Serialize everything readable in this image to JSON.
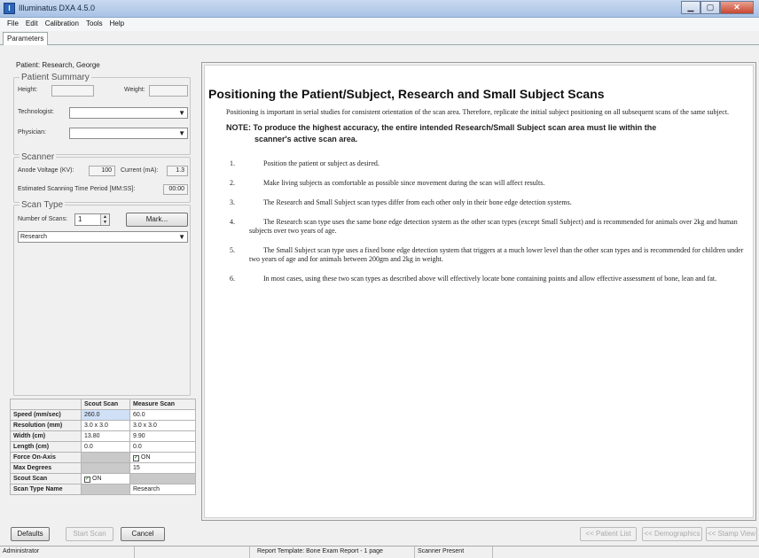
{
  "window": {
    "title": "Illuminatus DXA 4.5.0",
    "icon": "app-icon",
    "min": "▁",
    "max": "▢",
    "close": "✕"
  },
  "menu": [
    "File",
    "Edit",
    "Calibration",
    "Tools",
    "Help"
  ],
  "tabs": {
    "active": "Parameters"
  },
  "left": {
    "patient_label": "Patient:",
    "patient_name": "Research, George",
    "summary": {
      "title": "Patient Summary",
      "height_label": "Height:",
      "weight_label": "Weight:",
      "technologist_label": "Technologist:",
      "physician_label": "Physician:",
      "technologist_value": "",
      "physician_value": ""
    },
    "scanner": {
      "title": "Scanner",
      "voltage_label": "Anode Voltage (KV):",
      "voltage_value": "100",
      "current_label": "Current (mA):",
      "current_value": "1.3",
      "time_label": "Estimated Scanning Time Period [MM:SS]:",
      "time_value": "00:00"
    },
    "scan_type": {
      "title": "Scan Type",
      "num_label": "Number of Scans:",
      "num_value": "1",
      "mark_button": "Mark...",
      "type_value": "Research"
    }
  },
  "table": {
    "headers": [
      "",
      "Scout Scan",
      "Measure Scan"
    ],
    "rows": [
      {
        "label": "Speed (mm/sec)",
        "scout": "260.0",
        "measure": "60.0"
      },
      {
        "label": "Resolution (mm)",
        "scout": "3.0 x 3.0",
        "measure": "3.0 x 3.0"
      },
      {
        "label": "Width (cm)",
        "scout": "13.80",
        "measure": "9.90"
      },
      {
        "label": "Length (cm)",
        "scout": "0.0",
        "measure": "0.0"
      },
      {
        "label": "Force On-Axis",
        "scout": "",
        "measure": "ON"
      },
      {
        "label": "Max Degrees",
        "scout": "",
        "measure": "15"
      },
      {
        "label": "Scout Scan",
        "scout": "ON",
        "measure": ""
      },
      {
        "label": "Scan Type Name",
        "scout": "",
        "measure": "Research"
      }
    ]
  },
  "doc": {
    "title": "Positioning the Patient/Subject, Research and Small Subject Scans",
    "intro": "Positioning is important in serial studies for consistent orientation of the scan area.  Therefore, replicate the initial subject positioning on all subsequent scans of the same subject.",
    "note_line1": "NOTE:  To produce the highest accuracy, the entire intended Research/Small Subject scan area must lie within the",
    "note_line2": "scanner's active scan area.",
    "steps": [
      {
        "num": "1.",
        "text": "Position the patient or subject as desired."
      },
      {
        "num": "2.",
        "text": "Make living subjects as comfortable as possible since movement during the scan will affect results."
      },
      {
        "num": "3.",
        "text": "The Research and Small Subject scan types differ from each other only in their bone edge detection systems."
      },
      {
        "num": "4.",
        "text": "The Research scan type uses the same bone edge detection system as the other scan types (except Small Subject) and is recommended for animals over 2kg and human subjects over two years of age."
      },
      {
        "num": "5.",
        "text": "The Small Subject scan type uses a fixed bone edge detection system that triggers at a much lower level than the other scan types and is recommended for children under two years of age and for animals between 200gm and 2kg in weight."
      },
      {
        "num": "6.",
        "text": "In most cases, using these two scan types as described above will effectively locate bone containing points and allow effective assessment of bone, lean and fat."
      }
    ]
  },
  "bottom": {
    "defaults": "Defaults",
    "start": "Start Scan",
    "cancel": "Cancel",
    "patient_list": "<< Patient List",
    "demographics": "<< Demographics",
    "stamp_view": "<< Stamp View"
  },
  "status": {
    "user": "Administrator",
    "template": "Report Template: Bone Exam Report - 1 page",
    "scanner": "Scanner Present"
  }
}
